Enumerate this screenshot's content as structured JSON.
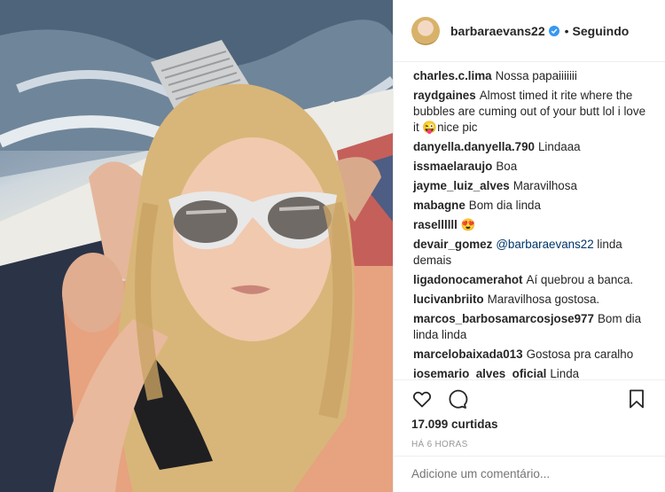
{
  "post": {
    "author": "barbaraevans22",
    "follow_status": "Seguindo",
    "separator": "•",
    "likes": "17.099 curtidas",
    "time": "HÁ 6 HORAS",
    "add_comment_placeholder": "Adicione um comentário..."
  },
  "comments": [
    {
      "user": "charles.c.lima",
      "text": "Nossa papaiiiiiii"
    },
    {
      "user": "raydgaines",
      "text": "Almost timed it rite where the bubbles are cuming out of your butt lol i love it 😜nice pic"
    },
    {
      "user": "danyella.danyella.790",
      "text": "Lindaaa"
    },
    {
      "user": "issmaelaraujo",
      "text": "Boa"
    },
    {
      "user": "jayme_luiz_alves",
      "text": "Maravilhosa"
    },
    {
      "user": "mabagne",
      "text": "Bom dia linda"
    },
    {
      "user": "rasellllll",
      "text": "😍"
    },
    {
      "user": "devair_gomez",
      "mention": "@barbaraevans22",
      "text": "linda demais"
    },
    {
      "user": "ligadonocamerahot",
      "text": "Aí quebrou a banca."
    },
    {
      "user": "lucivanbriito",
      "text": "Maravilhosa gostosa."
    },
    {
      "user": "marcos_barbosamarcosjose977",
      "text": "Bom dia linda linda"
    },
    {
      "user": "marcelobaixada013",
      "text": "Gostosa pra caralho"
    },
    {
      "user": "josemario_alves_oficial",
      "text": "Linda"
    }
  ],
  "icons": {
    "like": "heart-icon",
    "comment": "comment-bubble-icon",
    "save": "bookmark-icon",
    "verified": "verified-badge-icon"
  },
  "colors": {
    "verified": "#3897f0",
    "mention": "#003569",
    "muted": "#999999",
    "text": "#262626"
  }
}
